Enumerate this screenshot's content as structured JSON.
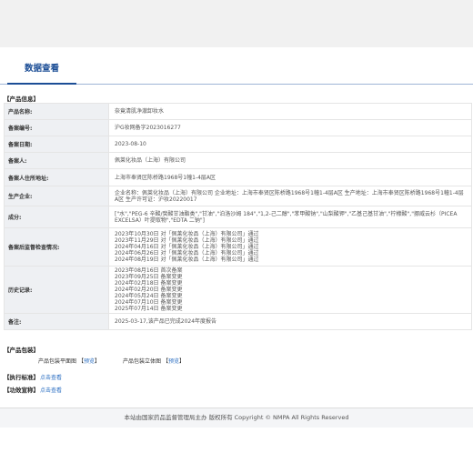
{
  "tab_title": "数据查看",
  "product_info_header": "【产品信息】",
  "rows": [
    {
      "label": "产品名称:",
      "value": "奈竟清肌净澈卸妆水"
    },
    {
      "label": "备案编号:",
      "value": "沪G妆网备字2023016277"
    },
    {
      "label": "备案日期:",
      "value": "2023-08-10"
    },
    {
      "label": "备案人:",
      "value": "佩莱化妆品（上海）有限公司"
    },
    {
      "label": "备案人住所地址:",
      "value": "上海市奉贤区陈桥路1968号1幢1-4层A区"
    },
    {
      "label": "生产企业:",
      "value": "企业名称：佩莱化妆品（上海）有限公司 企业地址：上海市奉贤区陈桥路1968号1幢1-4层A区 生产地址：上海市奉贤区陈桥路1968号1幢1-4层A区 生产许可证：沪妆20220017"
    },
    {
      "label": "成分:",
      "value": "[\"水\",\"PEG-6 辛酸/癸酸甘油酯类\",\"甘油\",\"泊洛沙姆 184\",\"1,2-己二醇\",\"苯甲酸钠\",\"山梨酸钾\",\"乙基己基甘油\",\"柠檬酸\",\"挪威云杉（PICEA EXCELSA）叶提取物\",\"EDTA 二钠\"]"
    },
    {
      "label": "备案后监督检查情况:",
      "lines": [
        "2023年10月30日 对「佩莱化妆品（上海）有限公司」通过",
        "2023年11月29日 对「佩莱化妆品（上海）有限公司」通过",
        "2024年04月16日 对「佩莱化妆品（上海）有限公司」通过",
        "2024年06月26日 对「佩莱化妆品（上海）有限公司」通过",
        "2024年08月19日 对「佩莱化妆品（上海）有限公司」通过"
      ]
    },
    {
      "label": "历史记录:",
      "lines": [
        "2023年08月16日 首次备案",
        "2023年09月25日 备案变更",
        "2024年02月18日 备案变更",
        "2024年02月20日 备案变更",
        "2024年05月24日 备案变更",
        "2024年07月10日 备案变更",
        "2025年07月14日 备案变更"
      ]
    },
    {
      "label": "备注:",
      "value": "2025-03-17,该产品已完成2024年度报告"
    }
  ],
  "packaging_header": "【产品包装】",
  "packaging": {
    "flat_label": "产品包装平面图",
    "flat_link": "预览",
    "solid_label": "产品包装立体图",
    "solid_link": "预览",
    "bracket_open": "【",
    "bracket_close": "】"
  },
  "standard_header": "【执行标准】",
  "standard_link": "点击查看",
  "efficacy_header": "【功效宣称】",
  "efficacy_link": "点击查看",
  "footer": "本站由国家药品监督管理局主办 版权所有 Copyright © NMPA All Rights Reserved"
}
